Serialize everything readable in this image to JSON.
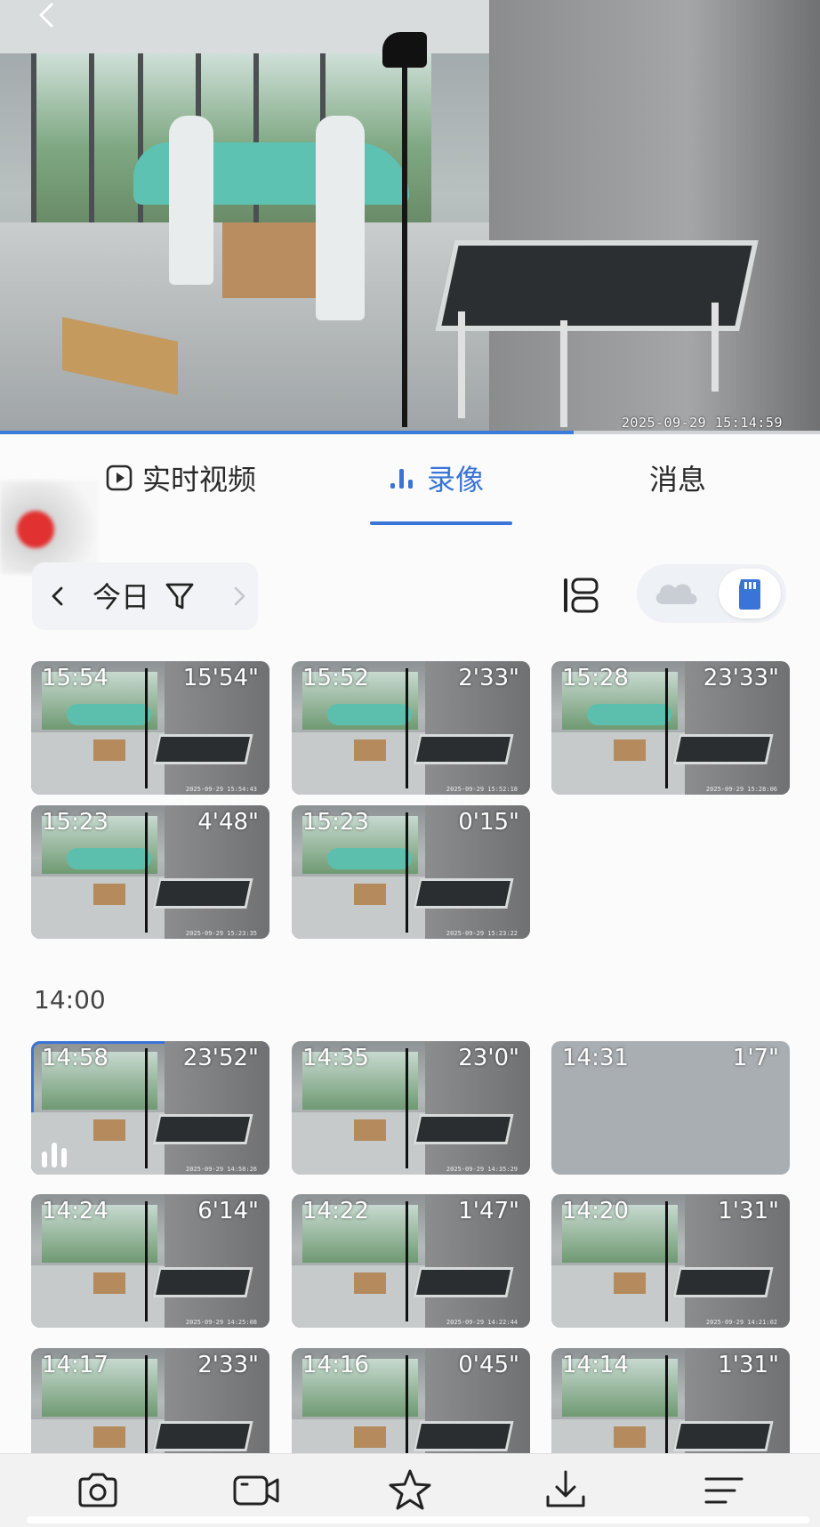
{
  "player": {
    "timestamp": "2025-09-29 15:14:59",
    "progress_fraction": 0.7
  },
  "tabs": [
    {
      "label": "实时视频",
      "icon": "play-icon",
      "active": false
    },
    {
      "label": "录像",
      "icon": "bars-icon",
      "active": true
    },
    {
      "label": "消息",
      "active": false
    }
  ],
  "filter": {
    "date_label": "今日"
  },
  "storage": {
    "options": [
      "cloud-icon",
      "sd-card-icon"
    ],
    "selected": "sd-card-icon"
  },
  "clips_group_top": [
    {
      "time": "15:54",
      "duration": "15'54\"",
      "stamp": "2025-09-29 15:54:43"
    },
    {
      "time": "15:52",
      "duration": "2'33\"",
      "stamp": "2025-09-29 15:52:18"
    },
    {
      "time": "15:28",
      "duration": "23'33\"",
      "stamp": "2025-09-29 15:28:06"
    },
    {
      "time": "15:23",
      "duration": "4'48\"",
      "stamp": "2025-09-29 15:23:35"
    },
    {
      "time": "15:23",
      "duration": "0'15\"",
      "stamp": "2025-09-29 15:23:22"
    }
  ],
  "section_14": {
    "label": "14:00",
    "clips": [
      {
        "time": "14:58",
        "duration": "23'52\"",
        "stamp": "2025-09-29 14:58:26",
        "selected": true
      },
      {
        "time": "14:35",
        "duration": "23'0\"",
        "stamp": "2025-09-29 14:35:29"
      },
      {
        "time": "14:31",
        "duration": "1'7\"",
        "stamp": ""
      },
      {
        "time": "14:24",
        "duration": "6'14\"",
        "stamp": "2025-09-29 14:25:08"
      },
      {
        "time": "14:22",
        "duration": "1'47\"",
        "stamp": "2025-09-29 14:22:44"
      },
      {
        "time": "14:20",
        "duration": "1'31\"",
        "stamp": "2025-09-29 14:21:02"
      },
      {
        "time": "14:17",
        "duration": "2'33\"",
        "stamp": ""
      },
      {
        "time": "14:16",
        "duration": "0'45\"",
        "stamp": ""
      },
      {
        "time": "14:14",
        "duration": "1'31\"",
        "stamp": ""
      }
    ]
  },
  "toolbar": {
    "items": [
      "camera-icon",
      "record-video-icon",
      "star-icon",
      "download-icon",
      "menu-icon"
    ]
  },
  "colors": {
    "accent": "#3a74d6",
    "text": "#222222"
  }
}
